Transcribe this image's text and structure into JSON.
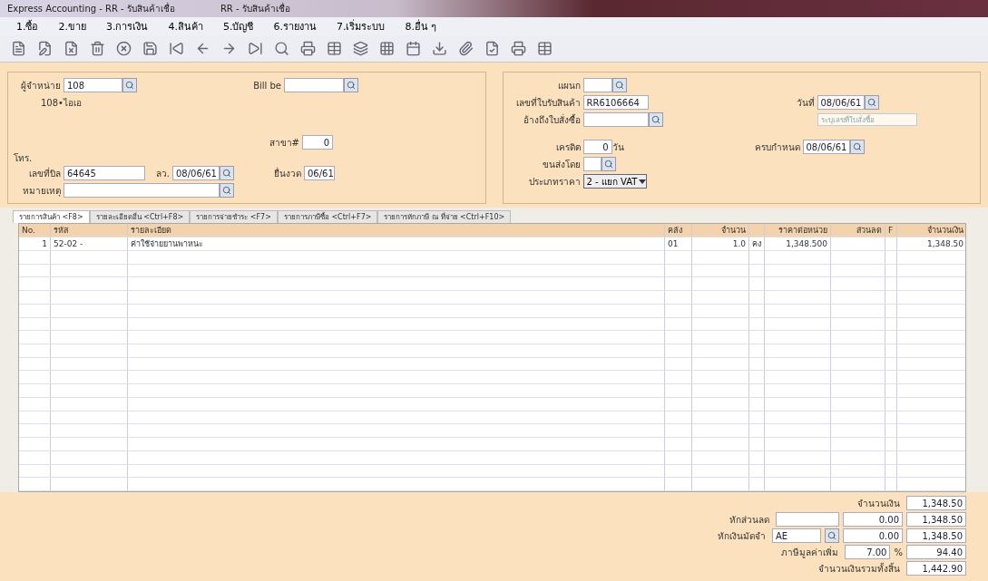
{
  "window": {
    "title": "Express Accounting - RR - รับสินค้าเชื่อ",
    "tab_title": "RR - รับสินค้าเชื่อ"
  },
  "menu": [
    "1.ซื้อ",
    "2.ขาย",
    "3.การเงิน",
    "4.สินค้า",
    "5.บัญชี",
    "6.รายงาน",
    "7.เริ่มระบบ",
    "8.อื่น ๆ"
  ],
  "header_left": {
    "vendor": {
      "label": "ผู้จำหน่าย",
      "value": "108"
    },
    "vendor_name": "108•ไอเอ",
    "bill": {
      "label": "Bill be"
    },
    "branch": {
      "label": "สาขา#",
      "value": "0"
    },
    "phone_label": "โทร.",
    "bill_no": {
      "label": "เลขที่บิล",
      "value": "64645"
    },
    "dated": {
      "label": "ลว.",
      "value": "08/06/61"
    },
    "period": {
      "label": "ยื่นงวด",
      "value": "06/61"
    },
    "note": {
      "label": "หมายเหตุ"
    }
  },
  "header_right": {
    "department": {
      "label": "แผนก"
    },
    "receipt_no": {
      "label": "เลขที่ใบรับสินค้า",
      "value": "RR6106664"
    },
    "po_ref": {
      "label": "อ้างถึงใบสั่งซื้อ"
    },
    "credit": {
      "label": "เครดิต",
      "value": "0",
      "unit": "วัน"
    },
    "shipping": {
      "label": "ขนส่งโดย"
    },
    "price_type": {
      "label": "ประเภทราคา",
      "value": "2 - แยก VAT"
    },
    "date": {
      "label": "วันที่",
      "value": "08/06/61",
      "placeholder": "ระบุเลขที่ใบสั่งซื้อ"
    },
    "due": {
      "label": "ครบกำหนด",
      "value": "08/06/61"
    }
  },
  "tabs": [
    {
      "label": "รายการสินค้า <F8>",
      "selected": true
    },
    {
      "label": "รายละเอียดอื่น <Ctrl+F8>",
      "selected": false
    },
    {
      "label": "รายการจ่ายชำระ <F7>",
      "selected": false
    },
    {
      "label": "รายการภาษีซื้อ <Ctrl+F7>",
      "selected": false
    },
    {
      "label": "รายการหักภาษี ณ ที่จ่าย <Ctrl+F10>",
      "selected": false
    }
  ],
  "table": {
    "columns": [
      "No.",
      "รหัส",
      "รายละเอียด",
      "คลัง",
      "จำนวน",
      "",
      "ราคาต่อหน่วย",
      "ส่วนลด",
      "F",
      "จำนวนเงิน"
    ],
    "rows": [
      [
        "1",
        "52-02 -",
        "ค่าใช้จ่ายยานพาหนะ",
        "01",
        "1.0",
        "คง",
        "1,348.500",
        "",
        "",
        "1,348.50"
      ]
    ]
  },
  "totals": {
    "amount": {
      "label": "จำนวนเงิน",
      "total": "1,348.50"
    },
    "discount": {
      "label": "หักส่วนลด",
      "value": "0.00",
      "total": "1,348.50"
    },
    "deposit": {
      "label": "หักเงินมัดจำ",
      "input": "AE",
      "value": "0.00",
      "total": "1,348.50"
    },
    "vat": {
      "label": "ภาษีมูลค่าเพิ่ม",
      "rate": "7.00",
      "unit": "%",
      "total": "94.40"
    },
    "grand": {
      "label": "จำนวนเงินรวมทั้งสิ้น",
      "total": "1,442.90"
    }
  }
}
